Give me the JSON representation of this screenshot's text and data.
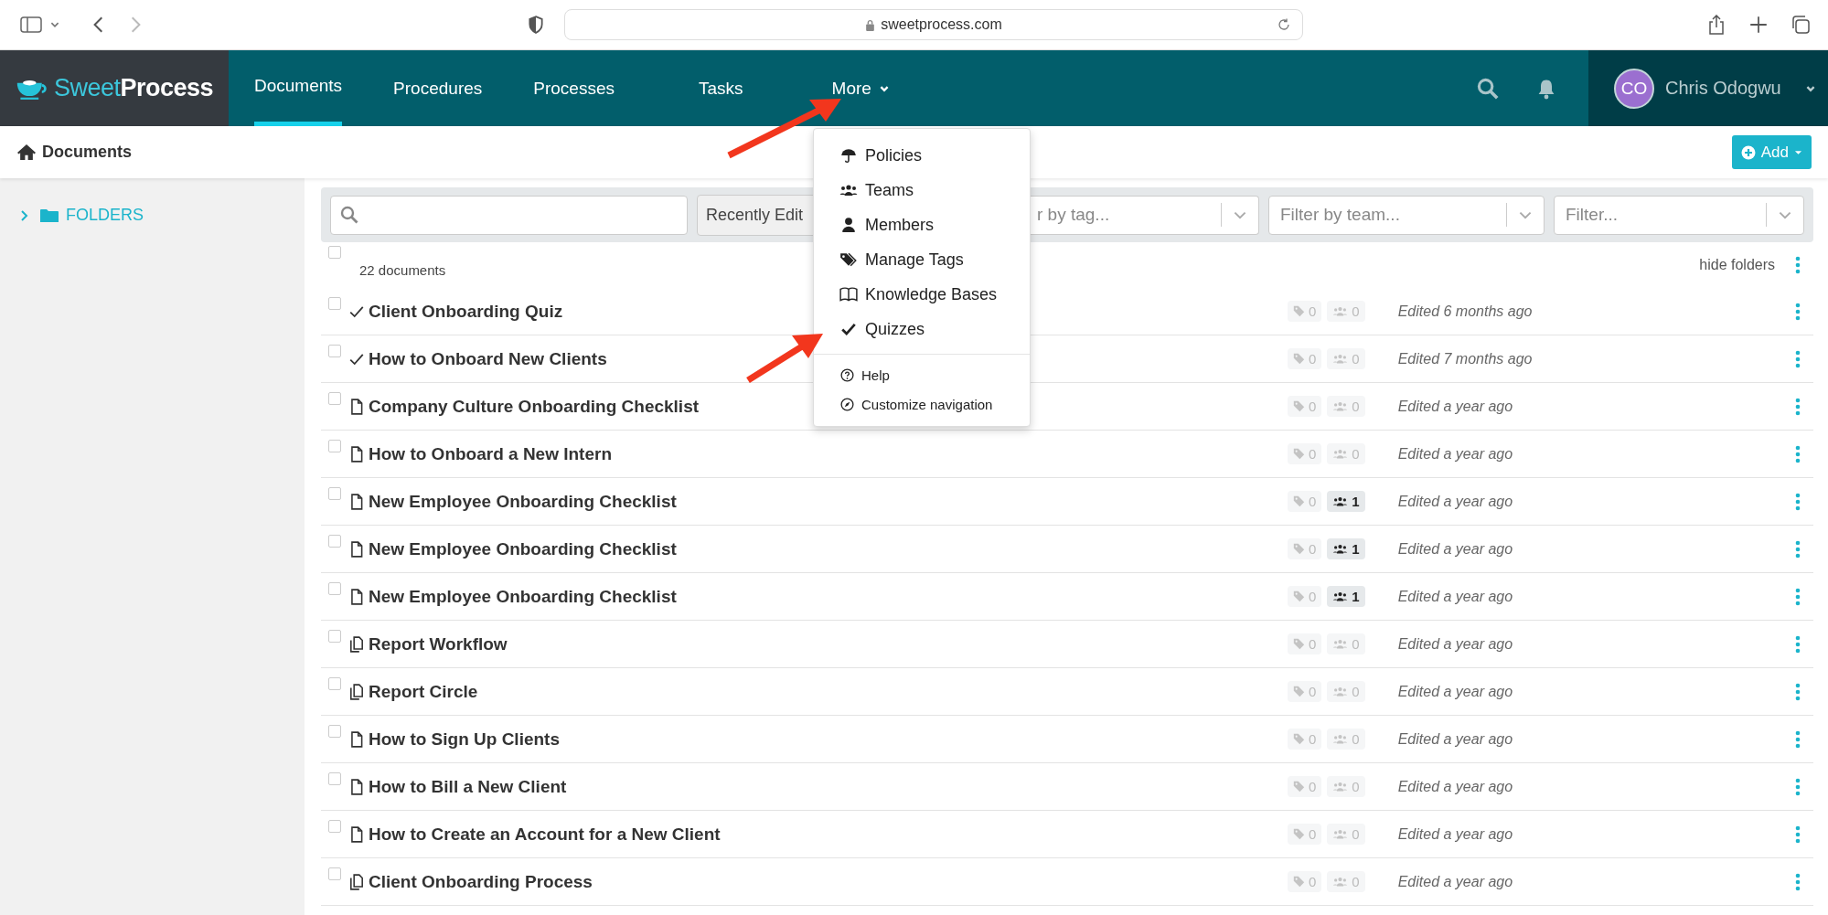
{
  "browser": {
    "address": "sweetprocess.com"
  },
  "nav": {
    "brand_light": "Sweet",
    "brand_bold": "Process",
    "tabs": [
      {
        "label": "Documents",
        "selected": true
      },
      {
        "label": "Procedures",
        "selected": false
      },
      {
        "label": "Processes",
        "selected": false
      },
      {
        "label": "Tasks",
        "selected": false
      },
      {
        "label": "More",
        "selected": false
      }
    ],
    "user": {
      "initials": "CO",
      "name": "Chris Odogwu"
    }
  },
  "subheader": {
    "title": "Documents",
    "add_button": "Add"
  },
  "sidebar": {
    "folders_label": "FOLDERS",
    "expanded": false
  },
  "filters": {
    "sort_value": "Recently Edit",
    "tag_placeholder": "r by tag...",
    "team_placeholder": "Filter by team...",
    "filter_placeholder": "Filter..."
  },
  "list_header": {
    "all_checked": false,
    "count": "22 documents",
    "hide_folders": "hide folders"
  },
  "rows": [
    {
      "checked": false,
      "kind": "quiz",
      "title": "Client Onboarding Quiz",
      "tags": "0",
      "teams": "0",
      "teams_highlighted": false,
      "edited": "Edited 6 months ago"
    },
    {
      "checked": false,
      "kind": "quiz",
      "title": "How to Onboard New Clients",
      "tags": "0",
      "teams": "0",
      "teams_highlighted": false,
      "edited": "Edited 7 months ago"
    },
    {
      "checked": false,
      "kind": "document",
      "title": "Company Culture Onboarding Checklist",
      "tags": "0",
      "teams": "0",
      "teams_highlighted": false,
      "edited": "Edited a year ago"
    },
    {
      "checked": false,
      "kind": "document",
      "title": "How to Onboard a New Intern",
      "tags": "0",
      "teams": "0",
      "teams_highlighted": false,
      "edited": "Edited a year ago"
    },
    {
      "checked": false,
      "kind": "document",
      "title": "New Employee Onboarding Checklist",
      "tags": "0",
      "teams": "1",
      "teams_highlighted": true,
      "edited": "Edited a year ago"
    },
    {
      "checked": false,
      "kind": "document",
      "title": "New Employee Onboarding Checklist",
      "tags": "0",
      "teams": "1",
      "teams_highlighted": true,
      "edited": "Edited a year ago"
    },
    {
      "checked": false,
      "kind": "document",
      "title": "New Employee Onboarding Checklist",
      "tags": "0",
      "teams": "1",
      "teams_highlighted": true,
      "edited": "Edited a year ago"
    },
    {
      "checked": false,
      "kind": "process",
      "title": "Report Workflow",
      "tags": "0",
      "teams": "0",
      "teams_highlighted": false,
      "edited": "Edited a year ago"
    },
    {
      "checked": false,
      "kind": "process",
      "title": "Report Circle",
      "tags": "0",
      "teams": "0",
      "teams_highlighted": false,
      "edited": "Edited a year ago"
    },
    {
      "checked": false,
      "kind": "document",
      "title": "How to Sign Up Clients",
      "tags": "0",
      "teams": "0",
      "teams_highlighted": false,
      "edited": "Edited a year ago"
    },
    {
      "checked": false,
      "kind": "document",
      "title": "How to Bill a New Client",
      "tags": "0",
      "teams": "0",
      "teams_highlighted": false,
      "edited": "Edited a year ago"
    },
    {
      "checked": false,
      "kind": "document",
      "title": "How to Create an Account for a New Client",
      "tags": "0",
      "teams": "0",
      "teams_highlighted": false,
      "edited": "Edited a year ago"
    },
    {
      "checked": false,
      "kind": "process",
      "title": "Client Onboarding Process",
      "tags": "0",
      "teams": "0",
      "teams_highlighted": false,
      "edited": "Edited a year ago"
    }
  ],
  "more_menu": {
    "items": [
      {
        "kind": "policies",
        "label": "Policies"
      },
      {
        "kind": "teams",
        "label": "Teams"
      },
      {
        "kind": "members",
        "label": "Members"
      },
      {
        "kind": "tags",
        "label": "Manage Tags"
      },
      {
        "kind": "knowledge",
        "label": "Knowledge Bases"
      },
      {
        "kind": "quizzes",
        "label": "Quizzes"
      }
    ],
    "footer_items": [
      {
        "kind": "help",
        "label": "Help"
      },
      {
        "kind": "customize",
        "label": "Customize navigation"
      }
    ]
  }
}
